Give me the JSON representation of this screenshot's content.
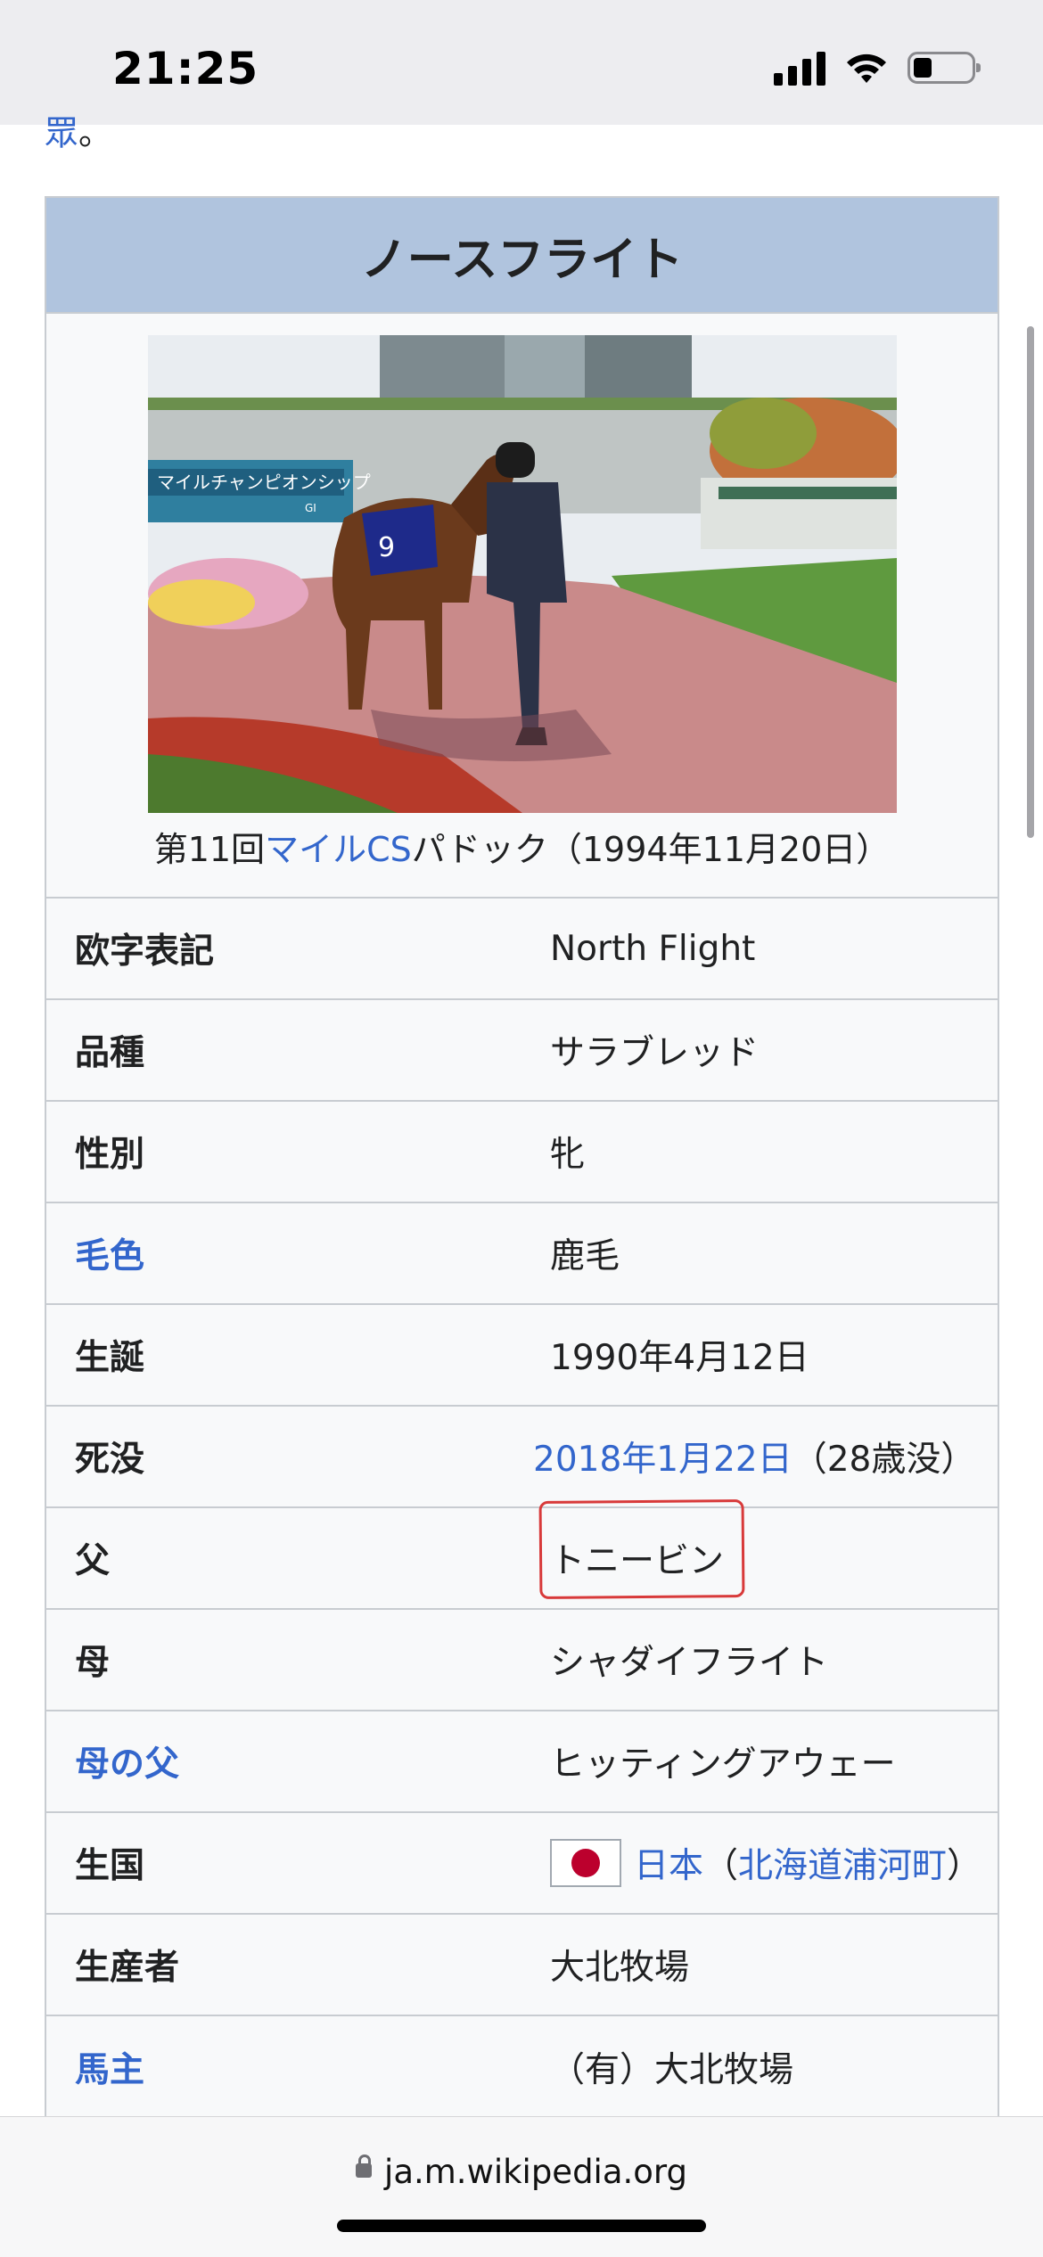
{
  "status_bar": {
    "time": "21:25"
  },
  "clipped_text": {
    "link": "眾",
    "tail": "。"
  },
  "infobox": {
    "title": "ノースフライト",
    "caption": {
      "prefix": "第11回",
      "link": "マイルCS",
      "suffix": "パドック（1994年11月20日）"
    },
    "photo_text": {
      "banner": "マイルチャンピオンシップ",
      "grade": "GI",
      "number": "9"
    },
    "rows": [
      {
        "label": "欧字表記",
        "value": "North Flight"
      },
      {
        "label": "品種",
        "value": "サラブレッド"
      },
      {
        "label": "性別",
        "value": "牝"
      },
      {
        "label": "毛色",
        "value": "鹿毛"
      },
      {
        "label": "生誕",
        "value": "1990年4月12日"
      },
      {
        "label": "死没",
        "value_link": "2018年1月22日",
        "value_suffix": "（28歳没）"
      },
      {
        "label": "父",
        "value": "トニービン"
      },
      {
        "label": "母",
        "value": "シャダイフライト"
      },
      {
        "label": "母の父",
        "value": "ヒッティングアウェー"
      },
      {
        "label": "生国",
        "value_link": "日本",
        "open": "（",
        "value_link2": "北海道浦河町",
        "close": "）"
      },
      {
        "label": "生産者",
        "value": "大北牧場"
      },
      {
        "label": "馬主",
        "value": "（有）大北牧場"
      }
    ]
  },
  "browser": {
    "url": "ja.m.wikipedia.org"
  },
  "colors": {
    "link": "#3366cc",
    "header_bg": "#b0c4de",
    "annotation": "#d83a3a"
  }
}
